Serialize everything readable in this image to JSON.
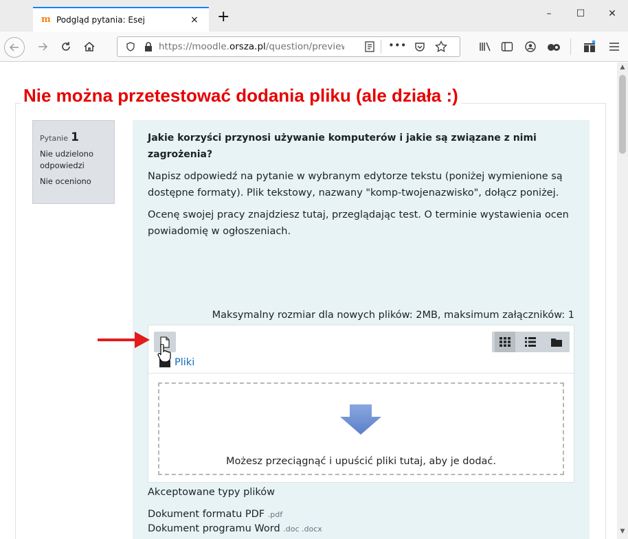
{
  "browser": {
    "tab_title": "Podgląd pytania: Esej",
    "tab_close": "×",
    "new_tab": "+",
    "url_prefix": "https://moodle.",
    "url_domain": "orsza.pl",
    "url_rest": "/question/preview",
    "window_controls": [
      "–",
      "☐",
      "✕"
    ]
  },
  "overlay": {
    "title": "Nie można przetestować dodania pliku (ale działa :)",
    "color": "#e60000"
  },
  "question_info": {
    "label": "Pytanie",
    "number": "1",
    "status": "Nie udzielono odpowiedzi",
    "grade": "Nie oceniono"
  },
  "question": {
    "heading": "Jakie korzyści przynosi używanie komputerów i jakie są związane z nimi zagrożenia?",
    "paragraph1": "Napisz odpowiedź na pytanie w wybranym edytorze tekstu (poniżej wymienione są dostępne formaty). Plik tekstowy, nazwany \"komp-twojenazwisko\", dołącz poniżej.",
    "paragraph2": "Ocenę swojej pracy znajdziesz tutaj, przeglądając test. O terminie wystawienia ocen powiadomię w ogłoszeniach."
  },
  "filemanager": {
    "max_size_text": "Maksymalny rozmiar dla nowych plików: 2MB, maksimum załączników: 1",
    "folder_label": "Pliki",
    "dropzone_text": "Możesz przeciągnąć i upuścić pliki tutaj, aby je dodać."
  },
  "accepted": {
    "title": "Akceptowane typy plików",
    "items": [
      {
        "name": "Dokument formatu PDF",
        "ext": ".pdf"
      },
      {
        "name": "Dokument programu Word",
        "ext": ".doc .docx"
      }
    ]
  },
  "colors": {
    "content_bg": "#e7f3f5",
    "link": "#0f6cbf",
    "arrow_red": "#e31b1b",
    "dropzone_arrow": "#6e8fd1"
  }
}
